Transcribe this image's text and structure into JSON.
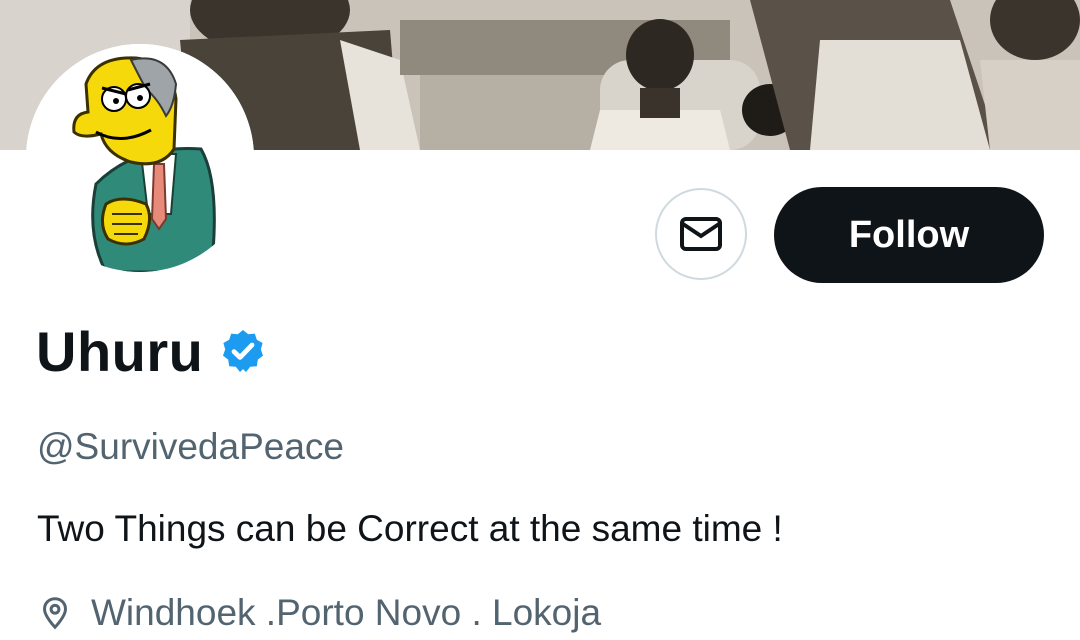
{
  "profile": {
    "display_name": "Uhuru",
    "verified": true,
    "handle": "@SurvivedaPeace",
    "bio": "Two Things can be Correct at the same time !",
    "location": "Windhoek .Porto Novo . Lokoja"
  },
  "actions": {
    "follow_label": "Follow",
    "message_icon": "mail-icon"
  },
  "icons": {
    "verified": "verified-badge-icon",
    "location": "location-pin-icon",
    "avatar": "cartoon-avatar"
  },
  "colors": {
    "text_primary": "#0f1419",
    "text_secondary": "#536471",
    "follow_bg": "#0f1419",
    "follow_text": "#ffffff",
    "verified_blue": "#1d9bf0",
    "button_border": "#cfd9de"
  }
}
